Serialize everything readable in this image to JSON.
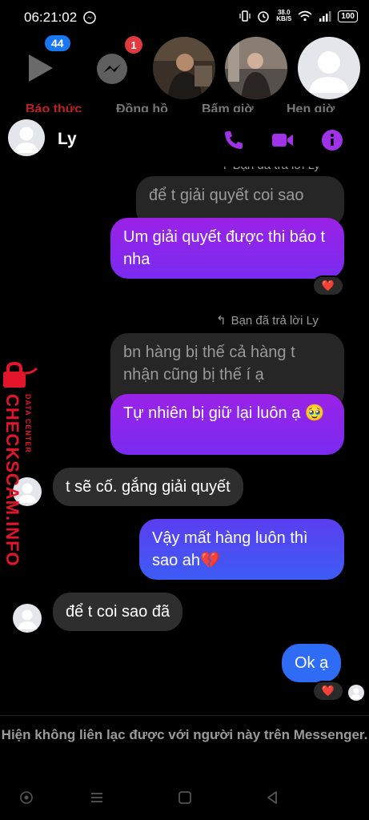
{
  "status_bar": {
    "time": "06:21:02",
    "speed_value": "38.0",
    "speed_unit": "KB/S",
    "battery": "100"
  },
  "stories": {
    "play_badge": "44",
    "messenger_badge": "1",
    "tabs": [
      "Báo thức",
      "Đồng hồ",
      "Bấm giờ",
      "Hẹn giờ"
    ]
  },
  "header": {
    "contact_name": "Ly"
  },
  "messages": {
    "reply_label_1": "Bạn đã trả lời Ly",
    "quoted_1": "để t giải quyết coi sao",
    "mine_1": "Um giải quyết được thi báo t nha",
    "reaction": "❤️",
    "reply_label_2": "Bạn đã trả lời Ly",
    "quoted_2": "bn hàng bị thế cả hàng t nhận cũng bị thế í ạ",
    "mine_2": "Tự nhiên bị giữ lại luôn ạ 🥹",
    "theirs_1": "t sẽ cố. gắng giải quyết",
    "mine_3": "Vậy mất hàng luôn thì sao ah💔",
    "theirs_2": "để t coi sao đã",
    "mine_4": "Ok ạ"
  },
  "watermark": {
    "brand": "CHECKSCAM.INFO",
    "sub": "DATA CENTER"
  },
  "footer": {
    "note": "Hiện không liên lạc được với người này trên Messenger."
  },
  "colors": {
    "accent": "#a033e8",
    "bubble_purple": "#8a26ec",
    "bubble_blue": "#2f6cf5",
    "watermark_red": "#e3152b"
  }
}
